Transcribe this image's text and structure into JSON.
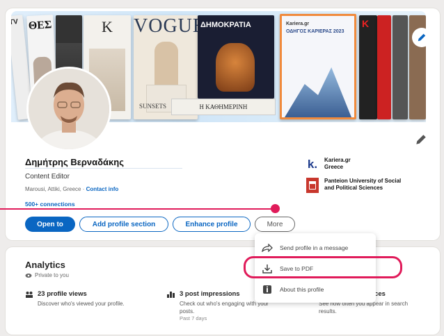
{
  "profile": {
    "name": "Δημήτρης Βερναδάκης",
    "headline": "Content Editor",
    "location": "Marousi, Attiki, Greece",
    "location_sep": " · ",
    "contact_info": "Contact info",
    "connections": "500+ connections"
  },
  "banner": {
    "magazines": [
      "TV",
      "ΘΕΣ",
      "K",
      "VOGUE",
      "ΔΗΜΟΚΡΑΤΙΑ",
      "Kariera.gr",
      "ΟΔΗΓΟΣ ΚΑΡΙΕΡΑΣ 2023",
      "K"
    ],
    "vogue_cover_line": "SUNSETS",
    "newspaper_line": "Η ΚΑΘΗΜΕΡΙΝΗ"
  },
  "companies": [
    {
      "name": "Kariera.gr",
      "subtitle": "Greece",
      "logo_text": "k."
    },
    {
      "name": "Panteion University of Social",
      "subtitle": "and Political Sciences",
      "logo_text": ""
    }
  ],
  "actions": {
    "open_to": "Open to",
    "add_section": "Add profile section",
    "enhance": "Enhance profile",
    "more": "More"
  },
  "more_menu": [
    {
      "label": "Send profile in a message",
      "icon": "share-arrow-icon"
    },
    {
      "label": "Save to PDF",
      "icon": "download-icon"
    },
    {
      "label": "About this profile",
      "icon": "info-badge-icon"
    }
  ],
  "analytics": {
    "title": "Analytics",
    "private": "Private to you",
    "metrics": [
      {
        "title": "23 profile views",
        "desc": "Discover who's viewed your profile.",
        "sub": ""
      },
      {
        "title": "3 post impressions",
        "desc": "Check out who's engaging with your posts.",
        "sub": "Past 7 days"
      },
      {
        "title": "arances",
        "desc": "See how often you appear in search results.",
        "sub": ""
      }
    ]
  },
  "colors": {
    "brand": "#0a66c2",
    "annotation": "#e01b5a",
    "magazine_highlight": "#f08a3c"
  }
}
